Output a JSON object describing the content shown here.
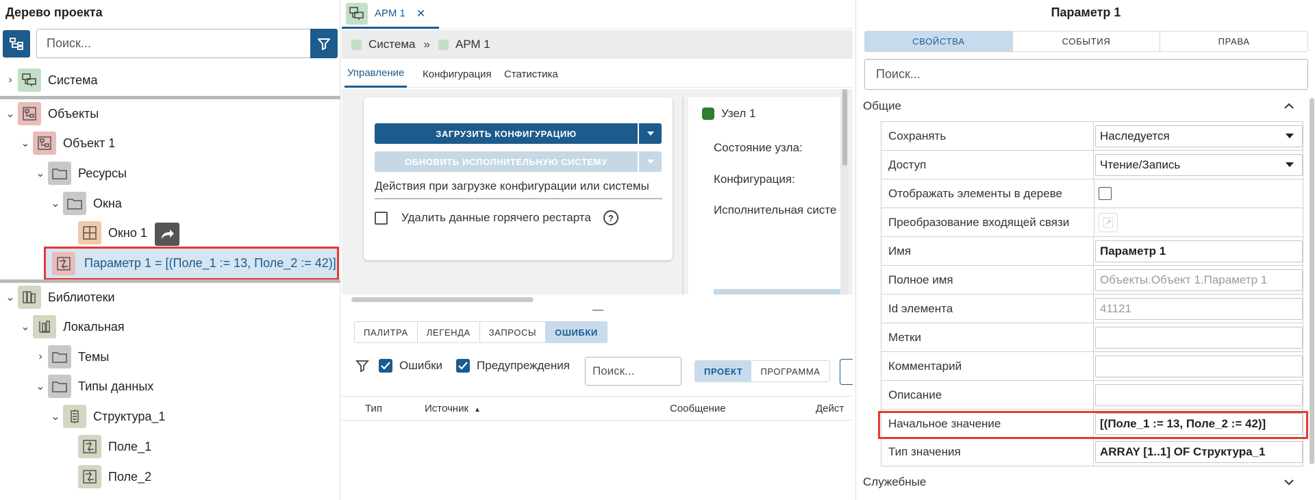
{
  "left_panel": {
    "title": "Дерево проекта",
    "search_placeholder": "Поиск...",
    "nodes": {
      "system": "Система",
      "objects": "Объекты",
      "object1": "Объект 1",
      "resources": "Ресурсы",
      "windows": "Окна",
      "window1": "Окно 1",
      "param1": "Параметр 1  =  [(Поле_1 := 13, Поле_2 := 42)]",
      "libraries": "Библиотеки",
      "local": "Локальная",
      "themes": "Темы",
      "datatypes": "Типы данных",
      "struct1": "Структура_1",
      "field1": "Поле_1",
      "field2": "Поле_2"
    }
  },
  "center_panel": {
    "doc_tab": "АРМ 1",
    "close_glyph": "✕",
    "breadcrumb": [
      "Система",
      "»",
      "АРМ 1"
    ],
    "subtabs": [
      "Управление",
      "Конфигурация",
      "Статистика"
    ],
    "load_config_button": "ЗАГРУЗИТЬ КОНФИГУРАЦИЮ",
    "update_system_button": "ОБНОВИТЬ ИСПОЛНИТЕЛЬНУЮ СИСТЕМУ",
    "actions_label": "Действия при загрузке конфигурации или системы",
    "delete_hot_restart": "Удалить данные горячего рестарта",
    "help_glyph": "?",
    "node": {
      "title": "Узел 1",
      "state": "Состояние узла:",
      "config": "Конфигурация:",
      "exec_system": "Исполнительная систе"
    },
    "bottom_tabs": [
      "ПАЛИТРА",
      "ЛЕГЕНДА",
      "ЗАПРОСЫ",
      "ОШИБКИ"
    ],
    "errors_checkbox": "Ошибки",
    "warnings_checkbox": "Предупреждения",
    "errors_search_placeholder": "Поиск...",
    "scope_tabs": [
      "ПРОЕКТ",
      "ПРОГРАММА"
    ],
    "grid_columns": [
      "Тип",
      "Источник",
      "Сообщение",
      "Дейст"
    ],
    "sort_glyph": "▲"
  },
  "right_panel": {
    "title": "Параметр 1",
    "tabs": [
      "СВОЙСТВА",
      "СОБЫТИЯ",
      "ПРАВА"
    ],
    "search_placeholder": "Поиск...",
    "group_general": "Общие",
    "group_service": "Служебные",
    "properties": [
      {
        "name": "Сохранять",
        "value": "Наследуется"
      },
      {
        "name": "Доступ",
        "value": "Чтение/Запись"
      },
      {
        "name": "Отображать элементы в дереве",
        "value": ""
      },
      {
        "name": "Преобразование входящей связи",
        "value": ""
      },
      {
        "name": "Имя",
        "value": "Параметр 1"
      },
      {
        "name": "Полное имя",
        "value": "Объекты.Объект 1.Параметр 1"
      },
      {
        "name": "Id элемента",
        "value": "41121"
      },
      {
        "name": "Метки",
        "value": ""
      },
      {
        "name": "Комментарий",
        "value": ""
      },
      {
        "name": "Описание",
        "value": ""
      },
      {
        "name": "Начальное значение",
        "value": "[(Поле_1 := 13, Поле_2 := 42)]"
      },
      {
        "name": "Тип значения",
        "value": "ARRAY [1..1] OF Структура_1"
      }
    ]
  },
  "colors": {
    "accent": "#1d5b8c",
    "highlight": "#e53935",
    "selection_bg": "#d5e5f1"
  }
}
